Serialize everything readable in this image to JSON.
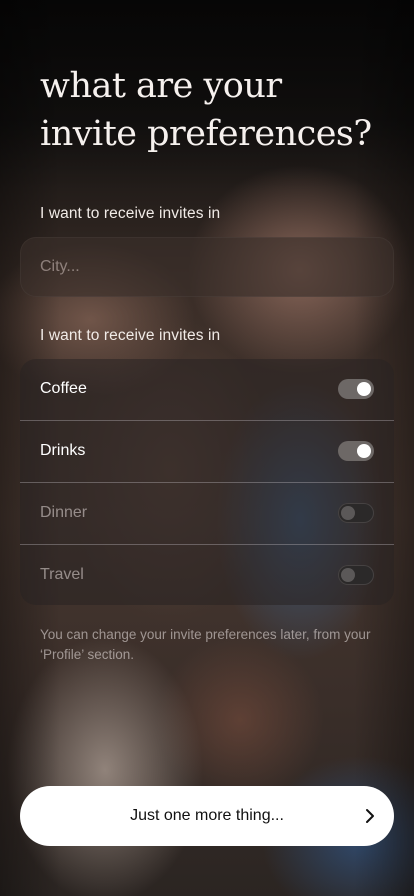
{
  "header": {
    "title": "what are your invite preferences?"
  },
  "location_section": {
    "label": "I want to receive invites in",
    "city_placeholder": "City...",
    "city_value": ""
  },
  "category_section": {
    "label": "I want to receive invites in",
    "items": [
      {
        "label": "Coffee",
        "enabled": true
      },
      {
        "label": "Drinks",
        "enabled": true
      },
      {
        "label": "Dinner",
        "enabled": false
      },
      {
        "label": "Travel",
        "enabled": false
      }
    ]
  },
  "helper_text": "You can change your invite preferences later, from your ‘Profile’ section.",
  "cta": {
    "label": "Just one more thing...",
    "icon": "chevron-right-icon"
  },
  "colors": {
    "cta_background": "#ffffff",
    "toggle_on_track": "#6d6866",
    "toggle_off_track": "#2b2929",
    "text_primary": "#ffffff"
  }
}
